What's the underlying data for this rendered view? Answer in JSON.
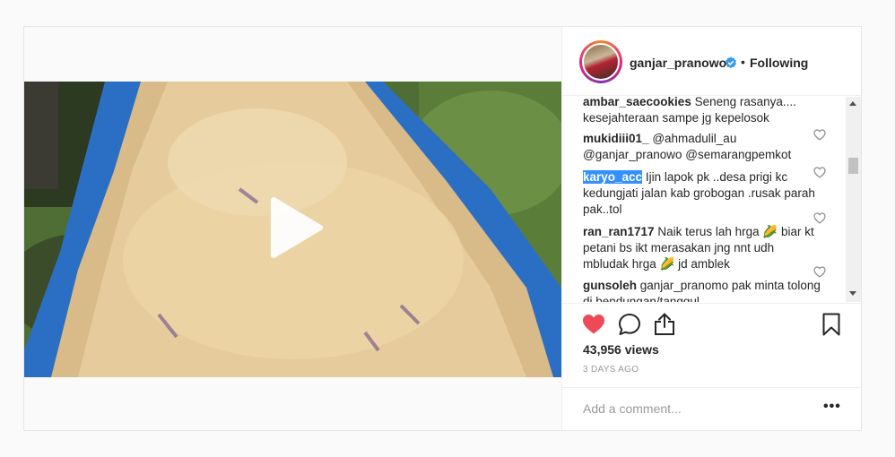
{
  "post": {
    "author": {
      "username": "ganjar_pranowo",
      "follow_state": "Following",
      "separator": "•"
    },
    "comments": [
      {
        "user": "ambar_saecookies",
        "text": "Seneng rasanya.... kesejahteraan sampe jg kepelosok",
        "selected": false
      },
      {
        "user": "mukidiii01_",
        "text": "@ahmadulil_au @ganjar_pranowo @semarangpemkot",
        "selected": false
      },
      {
        "user": "karyo_acc",
        "text": "Ijin lapok pk ..desa prigi kc kedungjati jalan kab grobogan .rusak parah pak..tol",
        "selected": true
      },
      {
        "user": "ran_ran1717",
        "text": "Naik terus lah hrga 🌽 biar kt petani bs ikt merasakan jng nnt udh mbludak hrga 🌽 jd amblek",
        "selected": false
      },
      {
        "user": "gunsoleh",
        "text": "ganjar_pranomo pak minta tolong di bendungan/tanggul",
        "selected": false
      }
    ],
    "views": "43,956 views",
    "date": "3 DAYS AGO",
    "add_comment_placeholder": "Add a comment...",
    "more_label": "•••",
    "liked": true,
    "colors": {
      "like_red": "#ed4956",
      "verified_blue": "#3897f0",
      "selection": "#3390ff"
    },
    "icons": [
      "play-icon",
      "verified-icon",
      "like-icon",
      "comment-icon",
      "share-icon",
      "save-icon",
      "comment-heart-icon"
    ]
  }
}
